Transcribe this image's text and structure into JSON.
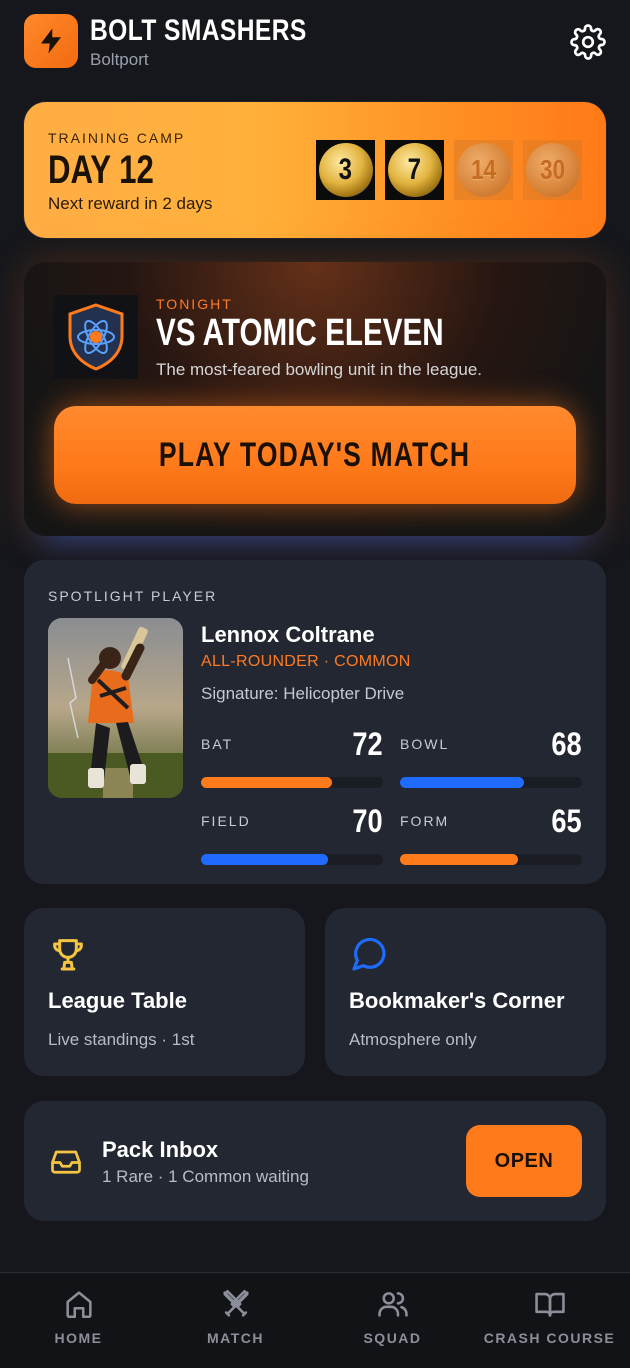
{
  "header": {
    "team_name": "BOLT SMASHERS",
    "city": "Boltport"
  },
  "training_camp": {
    "label": "TRAINING CAMP",
    "day": "DAY 12",
    "next_reward": "Next reward in 2 days",
    "milestones": [
      {
        "day": "3",
        "claimed": true
      },
      {
        "day": "7",
        "claimed": true
      },
      {
        "day": "14",
        "claimed": false
      },
      {
        "day": "30",
        "claimed": false
      }
    ]
  },
  "match": {
    "when": "TONIGHT",
    "opponent": "VS ATOMIC ELEVEN",
    "description": "The most-feared bowling unit in the league.",
    "play_label": "PLAY TODAY'S MATCH"
  },
  "spotlight": {
    "label": "SPOTLIGHT PLAYER",
    "name": "Lennox Coltrane",
    "role": "ALL-ROUNDER · COMMON",
    "signature": "Signature: Helicopter Drive",
    "stats": [
      {
        "label": "BAT",
        "value": "72",
        "color": "#ff7a1a"
      },
      {
        "label": "BOWL",
        "value": "68",
        "color": "#1f6bff"
      },
      {
        "label": "FIELD",
        "value": "70",
        "color": "#1f6bff"
      },
      {
        "label": "FORM",
        "value": "65",
        "color": "#ff7a1a"
      }
    ]
  },
  "tiles": {
    "league": {
      "title": "League Table",
      "subtitle": "Live standings · 1st",
      "icon": "trophy-icon"
    },
    "bookmaker": {
      "title": "Bookmaker's Corner",
      "subtitle": "Atmosphere only",
      "icon": "chat-icon"
    }
  },
  "pack": {
    "title": "Pack Inbox",
    "subtitle": "1 Rare · 1 Common waiting",
    "open_label": "OPEN"
  },
  "nav": {
    "items": [
      {
        "label": "HOME",
        "icon": "home-icon"
      },
      {
        "label": "MATCH",
        "icon": "crossed-bats-icon"
      },
      {
        "label": "SQUAD",
        "icon": "users-icon"
      },
      {
        "label": "CRASH COURSE",
        "icon": "book-icon"
      }
    ]
  },
  "colors": {
    "accent": "#ff7a1a",
    "blue": "#1f6bff",
    "gold": "#f5c542",
    "background": "#15171c",
    "card": "#232732"
  }
}
